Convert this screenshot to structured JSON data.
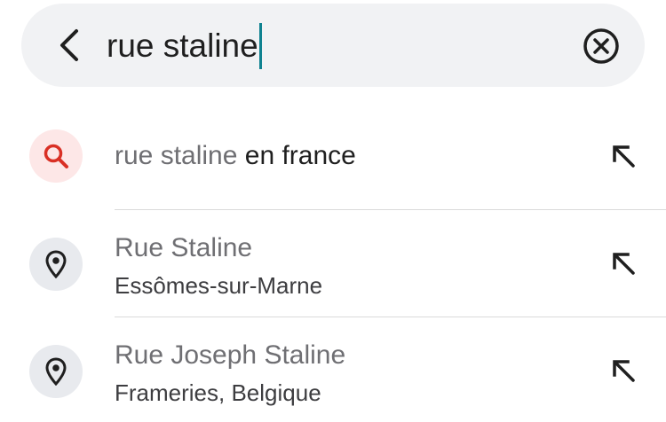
{
  "search": {
    "query": "rue staline",
    "back_icon": "chevron-left-icon",
    "clear_icon": "circle-x-icon"
  },
  "suggestions": [
    {
      "type": "query",
      "icon": "search-icon",
      "matched_text": "rue staline",
      "completion_text": "en france",
      "action_icon": "arrow-up-left-icon"
    },
    {
      "type": "place",
      "icon": "map-pin-icon",
      "title": "Rue Staline",
      "subtitle": "Essômes-sur-Marne",
      "action_icon": "arrow-up-left-icon"
    },
    {
      "type": "place",
      "icon": "map-pin-icon",
      "title": "Rue Joseph Staline",
      "subtitle": "Frameries, Belgique",
      "action_icon": "arrow-up-left-icon"
    }
  ],
  "colors": {
    "search_bar_bg": "#f1f2f4",
    "caret": "#0f8290",
    "search_icon_red": "#d93025",
    "search_icon_bg": "#fde7e7",
    "place_icon_bg": "#e8eaee",
    "muted_text": "#6f6f73",
    "divider": "#dadada"
  }
}
